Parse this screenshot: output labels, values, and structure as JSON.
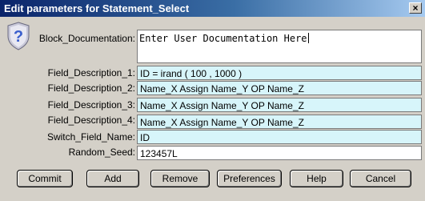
{
  "window": {
    "title": "Edit parameters for Statement_Select",
    "close_glyph": "×"
  },
  "help_icon": {
    "glyph": "?",
    "color": "#3a5fcd"
  },
  "fields": {
    "block_documentation": {
      "label": "Block_Documentation:",
      "value": "Enter User Documentation Here"
    },
    "field_description_1": {
      "label": "Field_Description_1:",
      "value": "ID = irand ( 100 , 1000 )"
    },
    "field_description_2": {
      "label": "Field_Description_2:",
      "value": "Name_X Assign Name_Y OP Name_Z"
    },
    "field_description_3": {
      "label": "Field_Description_3:",
      "value": "Name_X Assign Name_Y OP Name_Z"
    },
    "field_description_4": {
      "label": "Field_Description_4:",
      "value": "Name_X Assign Name_Y OP Name_Z"
    },
    "switch_field_name": {
      "label": "Switch_Field_Name:",
      "value": "ID"
    },
    "random_seed": {
      "label": "Random_Seed:",
      "value": "123457L"
    }
  },
  "colors": {
    "field_highlight": "#d7f5fa",
    "field_plain": "#ffffff",
    "dialog_bg": "#d4d0c8",
    "title_bar": "#0a246a"
  },
  "buttons": {
    "commit": "Commit",
    "add": "Add",
    "remove": "Remove",
    "preferences": "Preferences",
    "help": "Help",
    "cancel": "Cancel"
  }
}
